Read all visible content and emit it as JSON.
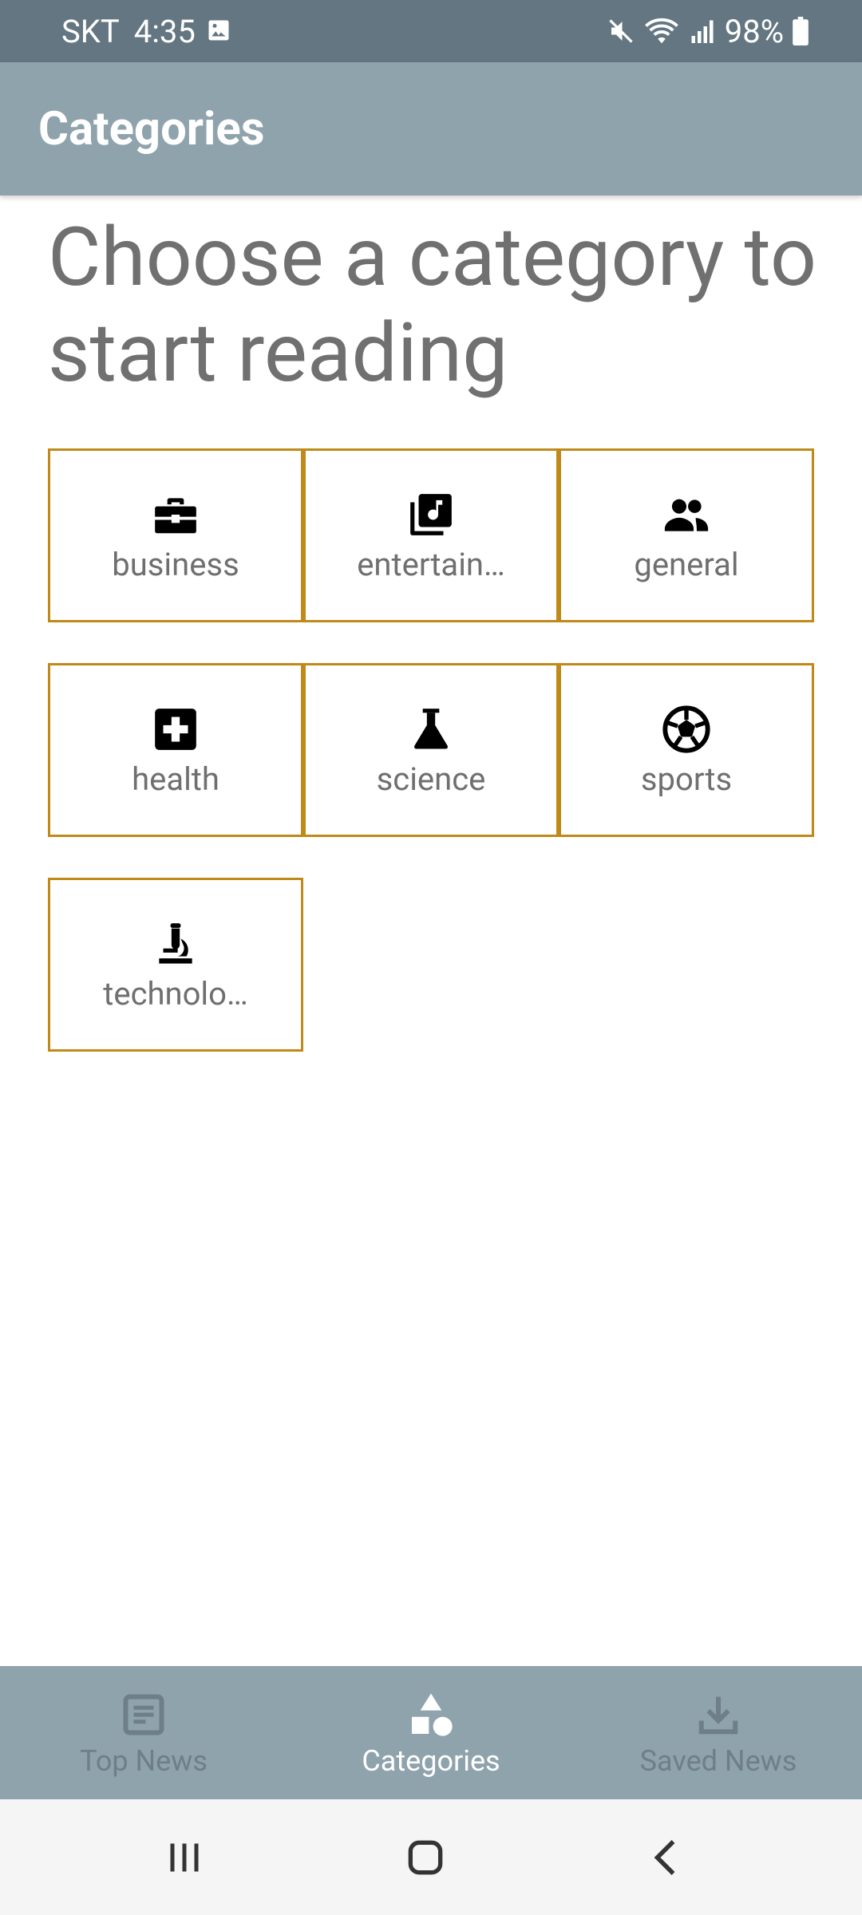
{
  "status_bar": {
    "carrier": "SKT",
    "time": "4:35",
    "battery": "98%"
  },
  "app_bar": {
    "title": "Categories"
  },
  "main": {
    "heading": "Choose a category to start reading",
    "categories": [
      {
        "label": "business",
        "icon": "briefcase-icon"
      },
      {
        "label": "entertain…",
        "icon": "library-music-icon"
      },
      {
        "label": "general",
        "icon": "people-icon"
      },
      {
        "label": "health",
        "icon": "medical-cross-icon"
      },
      {
        "label": "science",
        "icon": "flask-icon"
      },
      {
        "label": "sports",
        "icon": "soccer-ball-icon"
      },
      {
        "label": "technolo…",
        "icon": "microscope-icon"
      }
    ]
  },
  "bottom_nav": {
    "items": [
      {
        "label": "Top News",
        "icon": "article-icon",
        "active": false
      },
      {
        "label": "Categories",
        "icon": "category-shapes-icon",
        "active": true
      },
      {
        "label": "Saved News",
        "icon": "download-icon",
        "active": false
      }
    ]
  },
  "colors": {
    "status_bar": "#637681",
    "app_bar": "#8fa3ad",
    "tile_border": "#bf8a19",
    "heading_text": "#707070",
    "nav_inactive": "#6e7f88",
    "nav_active": "#ffffff"
  }
}
